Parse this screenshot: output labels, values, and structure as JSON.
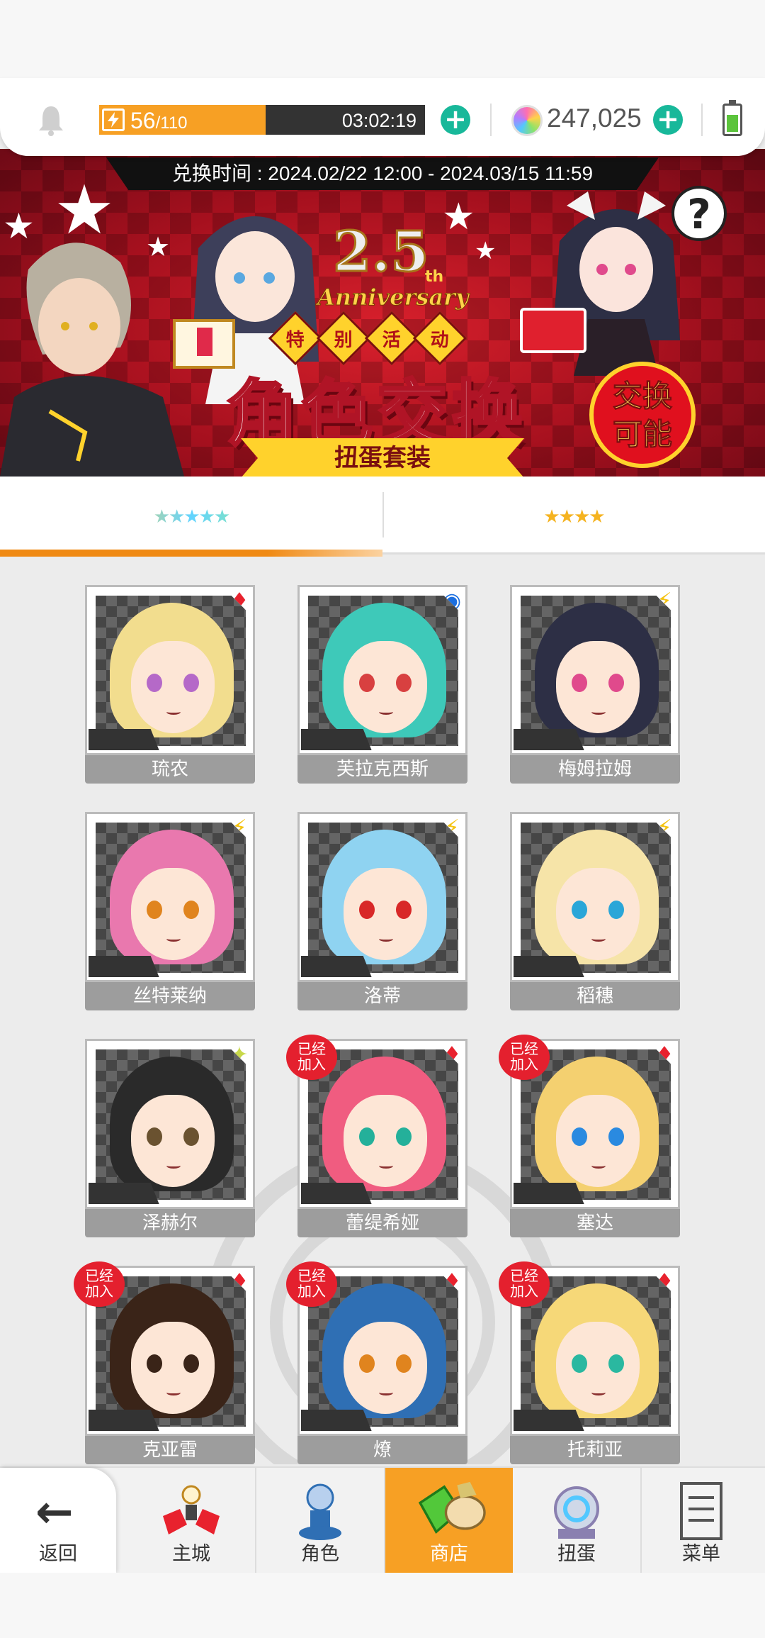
{
  "status": {
    "stamina_current": "56",
    "stamina_max": "/110",
    "stamina_fraction": 0.51,
    "stamina_timer": "03:02:19",
    "gems": "247,025",
    "battery_level": 0.6
  },
  "banner": {
    "exchange_period": "兑换时间 : 2024.02/22 12:00 - 2024.03/15 11:59",
    "anniversary_number": "2.5",
    "anniversary_suffix": "th",
    "anniversary_word": "Anniversary",
    "special_chars": [
      "特",
      "别",
      "活",
      "动"
    ],
    "main_title": "角色交换",
    "ribbon_text": "扭蛋套装",
    "badge_line1": "交换",
    "badge_line2": "可能",
    "help_label": "?"
  },
  "tabs": [
    {
      "stars": "★★★★★",
      "active": true
    },
    {
      "stars": "★★★★",
      "active": false
    }
  ],
  "owned_badge_line1": "已经",
  "owned_badge_line2": "加入",
  "characters": [
    {
      "name": "琉农",
      "element": "fire",
      "owned": false,
      "hair": "#f2dd8e",
      "eye": "#b569c8"
    },
    {
      "name": "芙拉克西斯",
      "element": "water",
      "owned": false,
      "hair": "#3ec9b9",
      "eye": "#d84040"
    },
    {
      "name": "梅姆拉姆",
      "element": "light",
      "owned": false,
      "hair": "#2d2f45",
      "eye": "#e04a8c"
    },
    {
      "name": "丝特莱纳",
      "element": "light",
      "owned": false,
      "hair": "#e978ae",
      "eye": "#e0841e"
    },
    {
      "name": "洛蒂",
      "element": "light",
      "owned": false,
      "hair": "#8fd3f1",
      "eye": "#d82828"
    },
    {
      "name": "稻穗",
      "element": "light",
      "owned": false,
      "hair": "#f6e4a8",
      "eye": "#2aa6d8"
    },
    {
      "name": "泽赫尔",
      "element": "wind",
      "owned": false,
      "hair": "#2a2a2a",
      "eye": "#6a5230"
    },
    {
      "name": "蕾缇希娅",
      "element": "fire",
      "owned": true,
      "hair": "#f05c80",
      "eye": "#24b09a"
    },
    {
      "name": "塞达",
      "element": "fire",
      "owned": true,
      "hair": "#f4d070",
      "eye": "#2a8ae0"
    },
    {
      "name": "克亚雷",
      "element": "fire",
      "owned": true,
      "hair": "#3a2418",
      "eye": "#3a2418"
    },
    {
      "name": "燎",
      "element": "fire",
      "owned": true,
      "hair": "#2f6fb4",
      "eye": "#e0841e"
    },
    {
      "name": "托莉亚",
      "element": "fire",
      "owned": true,
      "hair": "#f6d878",
      "eye": "#2ab8a0"
    }
  ],
  "card_stars": "★★★★★",
  "element_icons": {
    "fire": "diamonds-icon",
    "water": "water-orb-icon",
    "light": "lightning-icon",
    "wind": "sparkle-icon"
  },
  "nav": {
    "back": "返回",
    "items": [
      {
        "label": "主城",
        "icon": "castle-icon",
        "active": false
      },
      {
        "label": "角色",
        "icon": "character-icon",
        "active": false
      },
      {
        "label": "商店",
        "icon": "shop-bag-icon",
        "active": true
      },
      {
        "label": "扭蛋",
        "icon": "gacha-icon",
        "active": false
      },
      {
        "label": "菜单",
        "icon": "menu-list-icon",
        "active": false
      }
    ]
  },
  "colors": {
    "accent_orange": "#f7a024",
    "plus_green": "#18b89a",
    "owned_red": "#e4202e",
    "banner_red": "#c41826"
  }
}
